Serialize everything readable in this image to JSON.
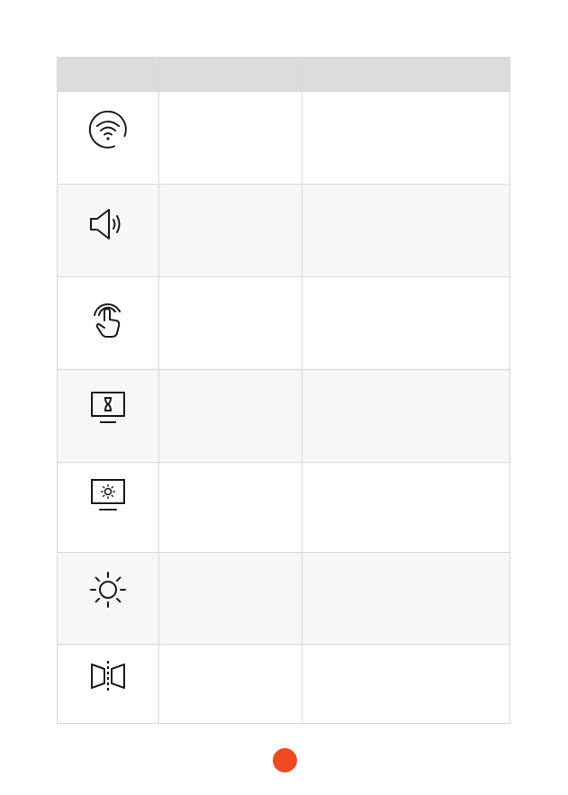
{
  "table": {
    "headers": [
      "",
      "",
      ""
    ],
    "rows": [
      {
        "icon": "wifi-icon",
        "col2": "",
        "col3": ""
      },
      {
        "icon": "speaker-volume-icon",
        "col2": "",
        "col3": ""
      },
      {
        "icon": "touch-tap-icon",
        "col2": "",
        "col3": ""
      },
      {
        "icon": "monitor-hourglass-icon",
        "col2": "",
        "col3": ""
      },
      {
        "icon": "monitor-brightness-icon",
        "col2": "",
        "col3": ""
      },
      {
        "icon": "brightness-sun-icon",
        "col2": "",
        "col3": ""
      },
      {
        "icon": "mirror-flip-icon",
        "col2": "",
        "col3": ""
      }
    ]
  },
  "colors": {
    "header_bg": "#dcdcdc",
    "alt_row_bg": "#f7f7f7",
    "border": "#d7d7d7",
    "icon_stroke": "#1a1a1a",
    "page_marker": "#ee4a22"
  }
}
